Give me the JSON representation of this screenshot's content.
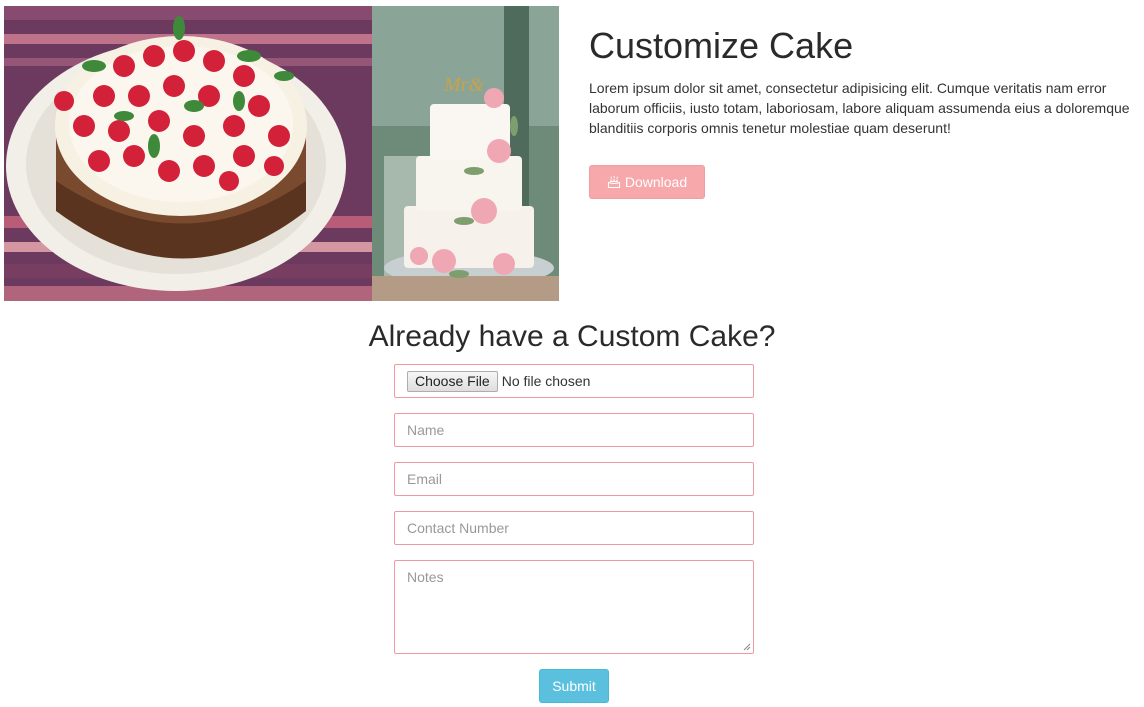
{
  "hero": {
    "title": "Customize Cake",
    "description_lines": [
      "Lorem ipsum dolor sit amet, consectetur adipisicing elit. Cumque veritatis nam error",
      "laborum officiis, iusto totam, laboriosam, labore aliquam assumenda eius a doloremque",
      "blanditiis corporis omnis tenetur molestiae quam deserunt!"
    ],
    "download_label": "Download",
    "download_icon": "cake-icon",
    "image_left": "raspberry-cake-photo",
    "image_right": "wedding-cake-photo"
  },
  "form": {
    "title": "Already have a Custom Cake?",
    "file_button": "Choose File",
    "file_status": "No file chosen",
    "name_placeholder": "Name",
    "email_placeholder": "Email",
    "contact_placeholder": "Contact Number",
    "notes_placeholder": "Notes",
    "submit_label": "Submit"
  },
  "colors": {
    "download_button": "#f7a8ab",
    "field_border": "#ef9b9e",
    "submit_button": "#5bc0de"
  }
}
